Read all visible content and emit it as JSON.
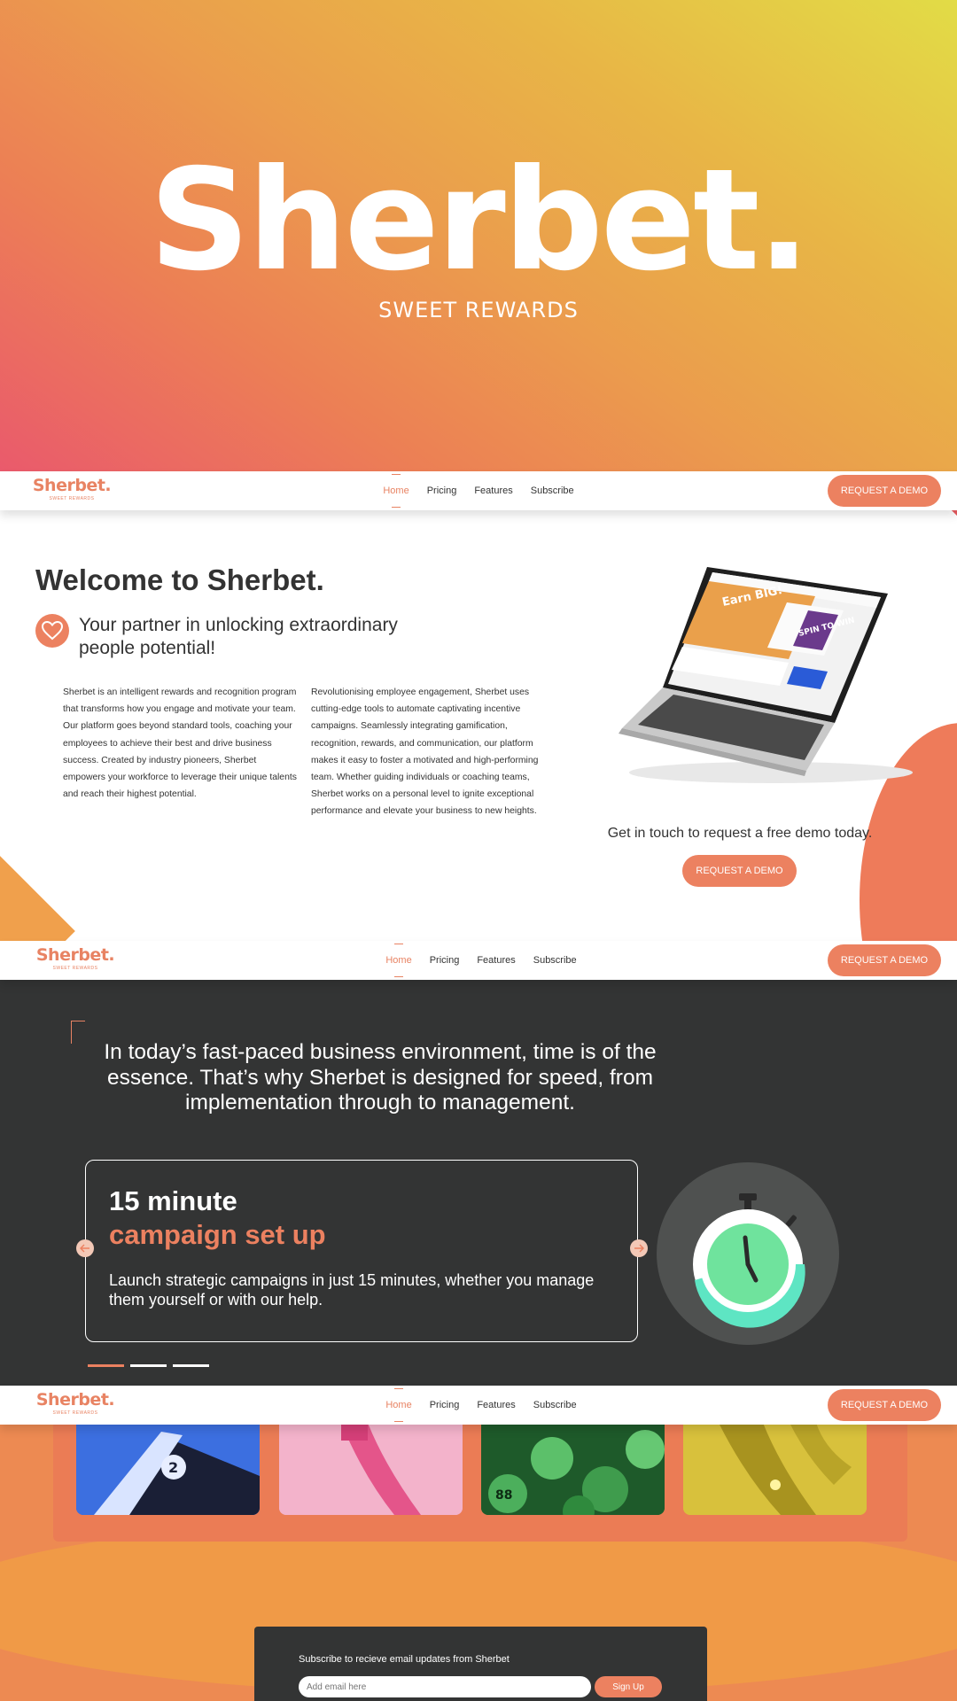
{
  "hero": {
    "logo": "Sherbet.",
    "tagline": "SWEET REWARDS"
  },
  "nav": {
    "brand_name": "Sherbet.",
    "brand_tag": "SWEET REWARDS",
    "links": [
      "Home",
      "Pricing",
      "Features",
      "Subscribe"
    ],
    "active": "Home",
    "cta": "REQUEST A DEMO"
  },
  "welcome": {
    "title": "Welcome to Sherbet.",
    "subtitle": "Your partner in unlocking extraordinary people potential!",
    "col1": "Sherbet is an intelligent rewards and recognition program that transforms how you engage and motivate your team. Our platform goes beyond standard tools, coaching your employees to achieve their best and drive business success. Created by industry pioneers, Sherbet empowers your workforce to leverage their unique talents and reach their highest potential.",
    "col2": "Revolutionising employee engagement, Sherbet uses cutting-edge tools to automate captivating incentive campaigns. Seamlessly integrating gamification, recognition, rewards, and communication, our platform makes it easy to foster a motivated and high-performing team. Whether guiding individuals or coaching teams, Sherbet works on a personal level to ignite exceptional performance and elevate your business to new heights.",
    "demo_text": "Get in touch to request a free demo today.",
    "demo_button": "REQUEST A DEMO",
    "laptop_screen": {
      "headline": "Earn BIG!",
      "promo": "SPIN TO WIN"
    }
  },
  "speed": {
    "quote": "In today’s fast-paced business environment, time is of the essence. That’s why Sherbet is designed for speed, from implementation through to management.",
    "slide_title_1": "15 minute",
    "slide_title_2": "campaign set up",
    "slide_text": "Launch strategic campaigns in just 15 minutes, whether you manage them yourself or with our help.",
    "slides_total": 3,
    "active_slide": 1
  },
  "subscribe": {
    "label": "Subscribe to recieve email updates from Sherbet",
    "placeholder": "Add email here",
    "button": "Sign Up"
  },
  "colors": {
    "accent": "#ec8160",
    "dark": "#333434",
    "hero_gradient": [
      "#e2dc46",
      "#e8b646",
      "#ec7f55",
      "#ea5a6c"
    ]
  }
}
